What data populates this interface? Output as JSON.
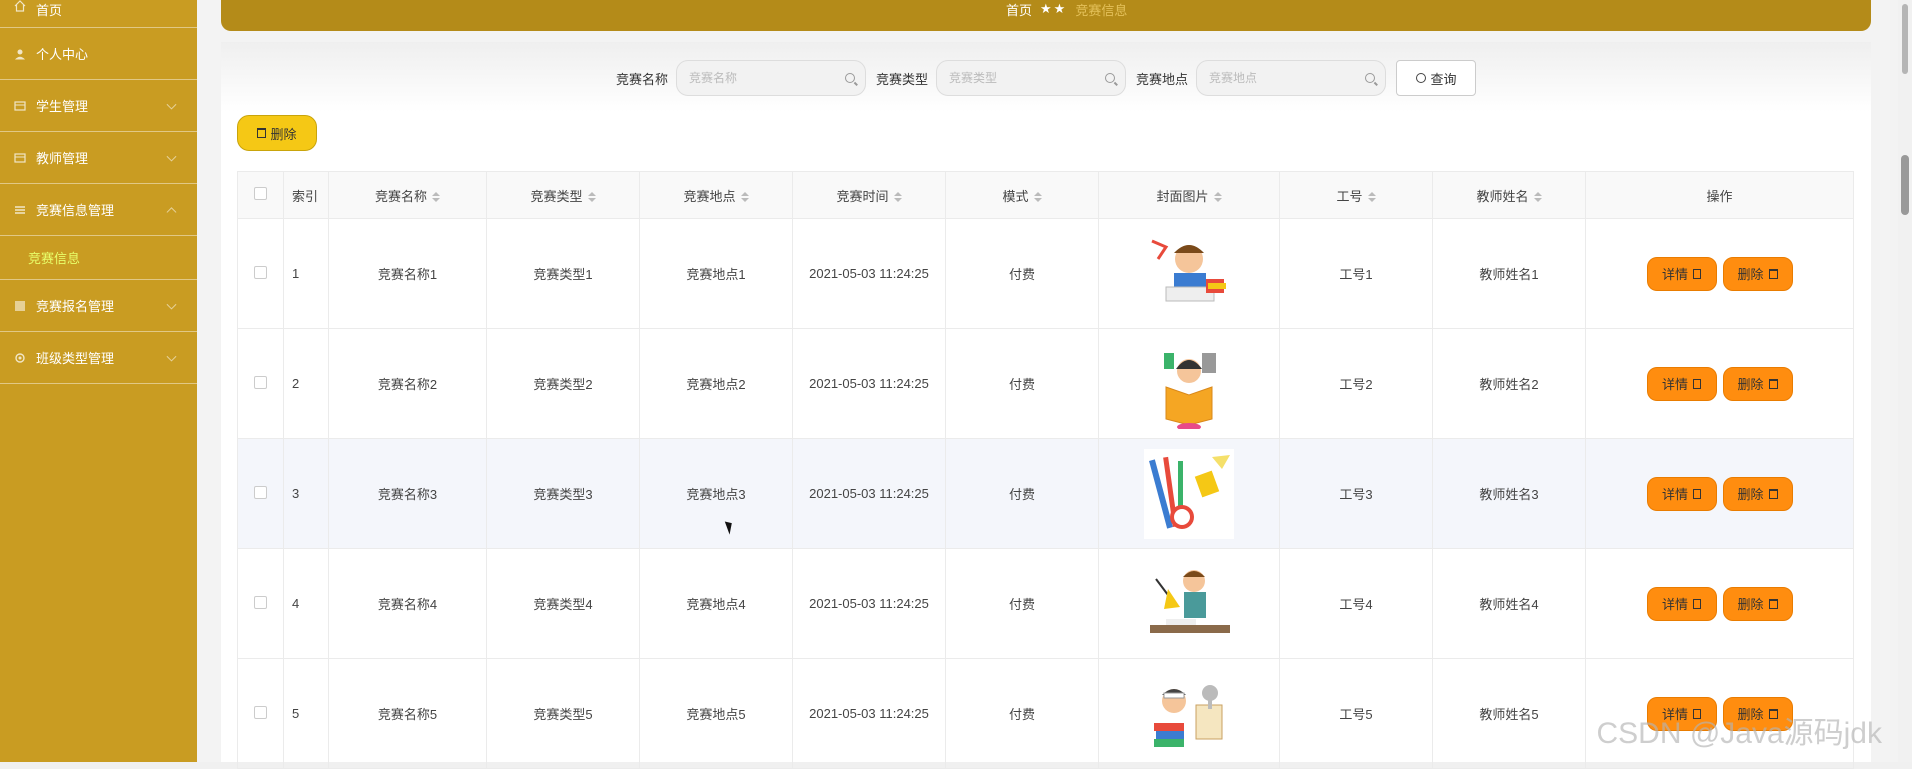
{
  "sidebar": {
    "items": [
      {
        "label": "首页",
        "icon": "home-icon"
      },
      {
        "label": "个人中心",
        "icon": "user-icon"
      },
      {
        "label": "学生管理",
        "icon": "menu-icon"
      },
      {
        "label": "教师管理",
        "icon": "menu-icon"
      },
      {
        "label": "竞赛信息管理",
        "icon": "menu-icon",
        "submenu": "竞赛信息"
      },
      {
        "label": "竞赛报名管理",
        "icon": "menu-icon"
      },
      {
        "label": "班级类型管理",
        "icon": "gear-icon"
      }
    ],
    "bg_color": "#c99c22",
    "sub_active_color": "#e8ff6a"
  },
  "breadcrumb": {
    "home": "首页",
    "stars": "★★",
    "current": "竞赛信息"
  },
  "search": {
    "fields": [
      {
        "label": "竞赛名称",
        "placeholder": "竞赛名称"
      },
      {
        "label": "竞赛类型",
        "placeholder": "竞赛类型"
      },
      {
        "label": "竞赛地点",
        "placeholder": "竞赛地点"
      }
    ],
    "query_label": "查询"
  },
  "toolbar": {
    "delete_label": "删除"
  },
  "table": {
    "headers": [
      "",
      "索引",
      "竞赛名称",
      "竞赛类型",
      "竞赛地点",
      "竞赛时间",
      "模式",
      "封面图片",
      "工号",
      "教师姓名",
      "操作"
    ],
    "rows": [
      {
        "index": "1",
        "name": "竞赛名称1",
        "type": "竞赛类型1",
        "place": "竞赛地点1",
        "time": "2021-05-03 11:24:25",
        "mode": "付费",
        "cover": "reading-boy",
        "job_no": "工号1",
        "teacher": "教师姓名1"
      },
      {
        "index": "2",
        "name": "竞赛名称2",
        "type": "竞赛类型2",
        "place": "竞赛地点2",
        "time": "2021-05-03 11:24:25",
        "mode": "付费",
        "cover": "reading-girl",
        "job_no": "工号2",
        "teacher": "教师姓名2"
      },
      {
        "index": "3",
        "name": "竞赛名称3",
        "type": "竞赛类型3",
        "place": "竞赛地点3",
        "time": "2021-05-03 11:24:25",
        "mode": "付费",
        "cover": "stationery",
        "job_no": "工号3",
        "teacher": "教师姓名3"
      },
      {
        "index": "4",
        "name": "竞赛名称4",
        "type": "竞赛类型4",
        "place": "竞赛地点4",
        "time": "2021-05-03 11:24:25",
        "mode": "付费",
        "cover": "studying-boy",
        "job_no": "工号4",
        "teacher": "教师姓名4"
      },
      {
        "index": "5",
        "name": "竞赛名称5",
        "type": "竞赛类型5",
        "place": "竞赛地点5",
        "time": "2021-05-03 11:24:25",
        "mode": "付费",
        "cover": "books-kid",
        "job_no": "工号5",
        "teacher": "教师姓名5"
      }
    ],
    "detail_label": "详情",
    "delete_label": "删除",
    "highlight_row": 3
  },
  "watermark": "CSDN @Java源码jdk",
  "colors": {
    "banner": "#b48b19",
    "action_btn": "#ff8d0f",
    "delete_btn": "#f5c815"
  }
}
